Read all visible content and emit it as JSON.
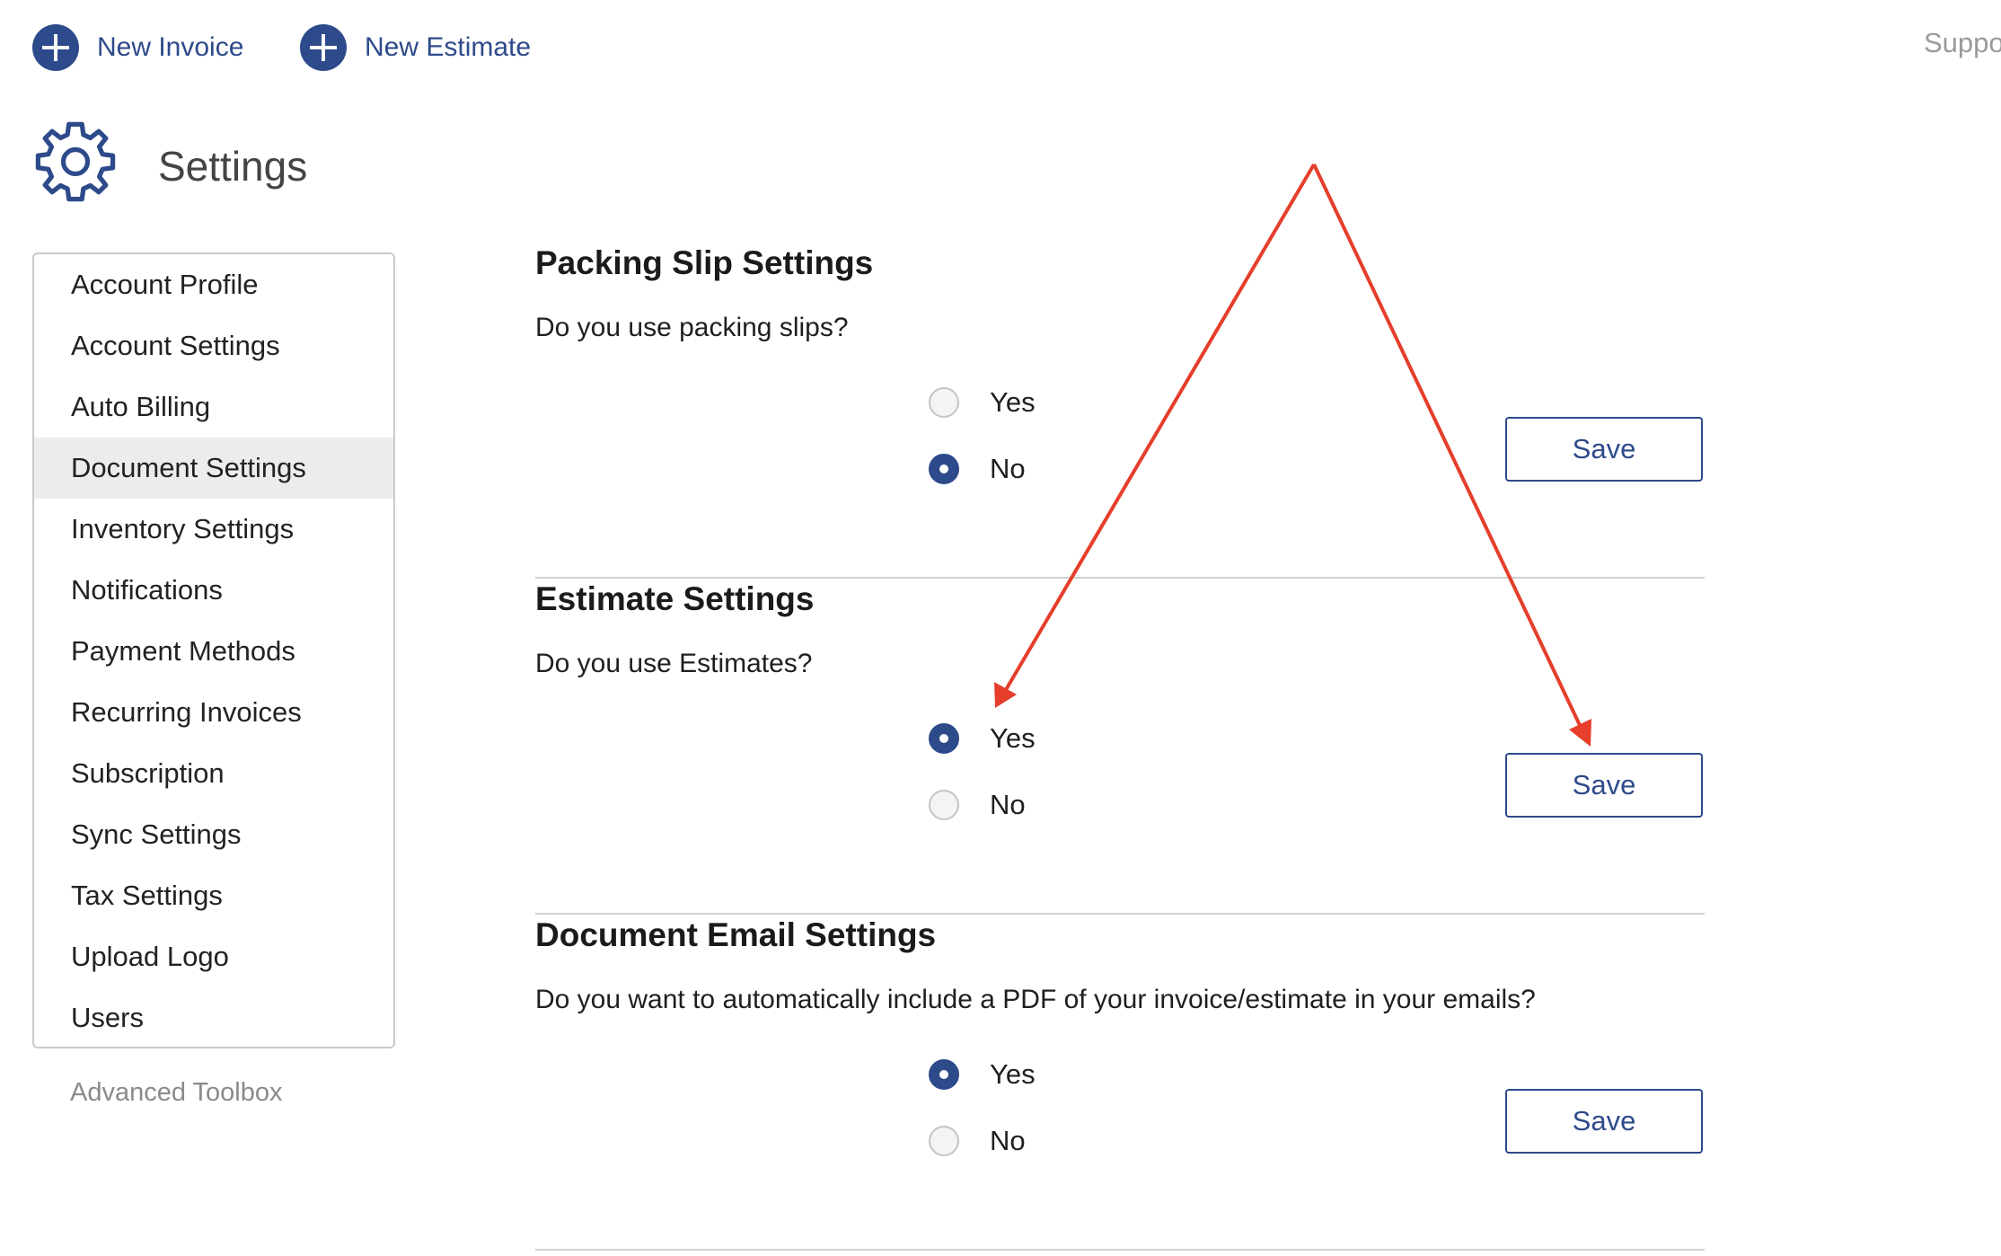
{
  "brand_color": "#2d4a8a",
  "annotation_color": "#e53e2a",
  "topbar": {
    "new_invoice": {
      "label": "New Invoice",
      "icon": "plus-circle-icon"
    },
    "new_estimate": {
      "label": "New Estimate",
      "icon": "plus-circle-icon"
    },
    "support_label": "Suppo"
  },
  "page": {
    "title": "Settings",
    "icon": "gear-icon"
  },
  "sidebar": {
    "items": [
      {
        "label": "Account Profile",
        "active": false
      },
      {
        "label": "Account Settings",
        "active": false
      },
      {
        "label": "Auto Billing",
        "active": false
      },
      {
        "label": "Document Settings",
        "active": true
      },
      {
        "label": "Inventory Settings",
        "active": false
      },
      {
        "label": "Notifications",
        "active": false
      },
      {
        "label": "Payment Methods",
        "active": false
      },
      {
        "label": "Recurring Invoices",
        "active": false
      },
      {
        "label": "Subscription",
        "active": false
      },
      {
        "label": "Sync Settings",
        "active": false
      },
      {
        "label": "Tax Settings",
        "active": false
      },
      {
        "label": "Upload Logo",
        "active": false
      },
      {
        "label": "Users",
        "active": false
      }
    ],
    "advanced": "Advanced Toolbox"
  },
  "sections": [
    {
      "title": "Packing Slip Settings",
      "question": "Do you use packing slips?",
      "options": [
        {
          "label": "Yes",
          "selected": false
        },
        {
          "label": "No",
          "selected": true
        }
      ],
      "save_label": "Save"
    },
    {
      "title": "Estimate Settings",
      "question": "Do you use Estimates?",
      "options": [
        {
          "label": "Yes",
          "selected": true
        },
        {
          "label": "No",
          "selected": false
        }
      ],
      "save_label": "Save"
    },
    {
      "title": "Document Email Settings",
      "question": "Do you want to automatically include a PDF of your invoice/estimate in your emails?",
      "options": [
        {
          "label": "Yes",
          "selected": true
        },
        {
          "label": "No",
          "selected": false
        }
      ],
      "save_label": "Save"
    }
  ]
}
